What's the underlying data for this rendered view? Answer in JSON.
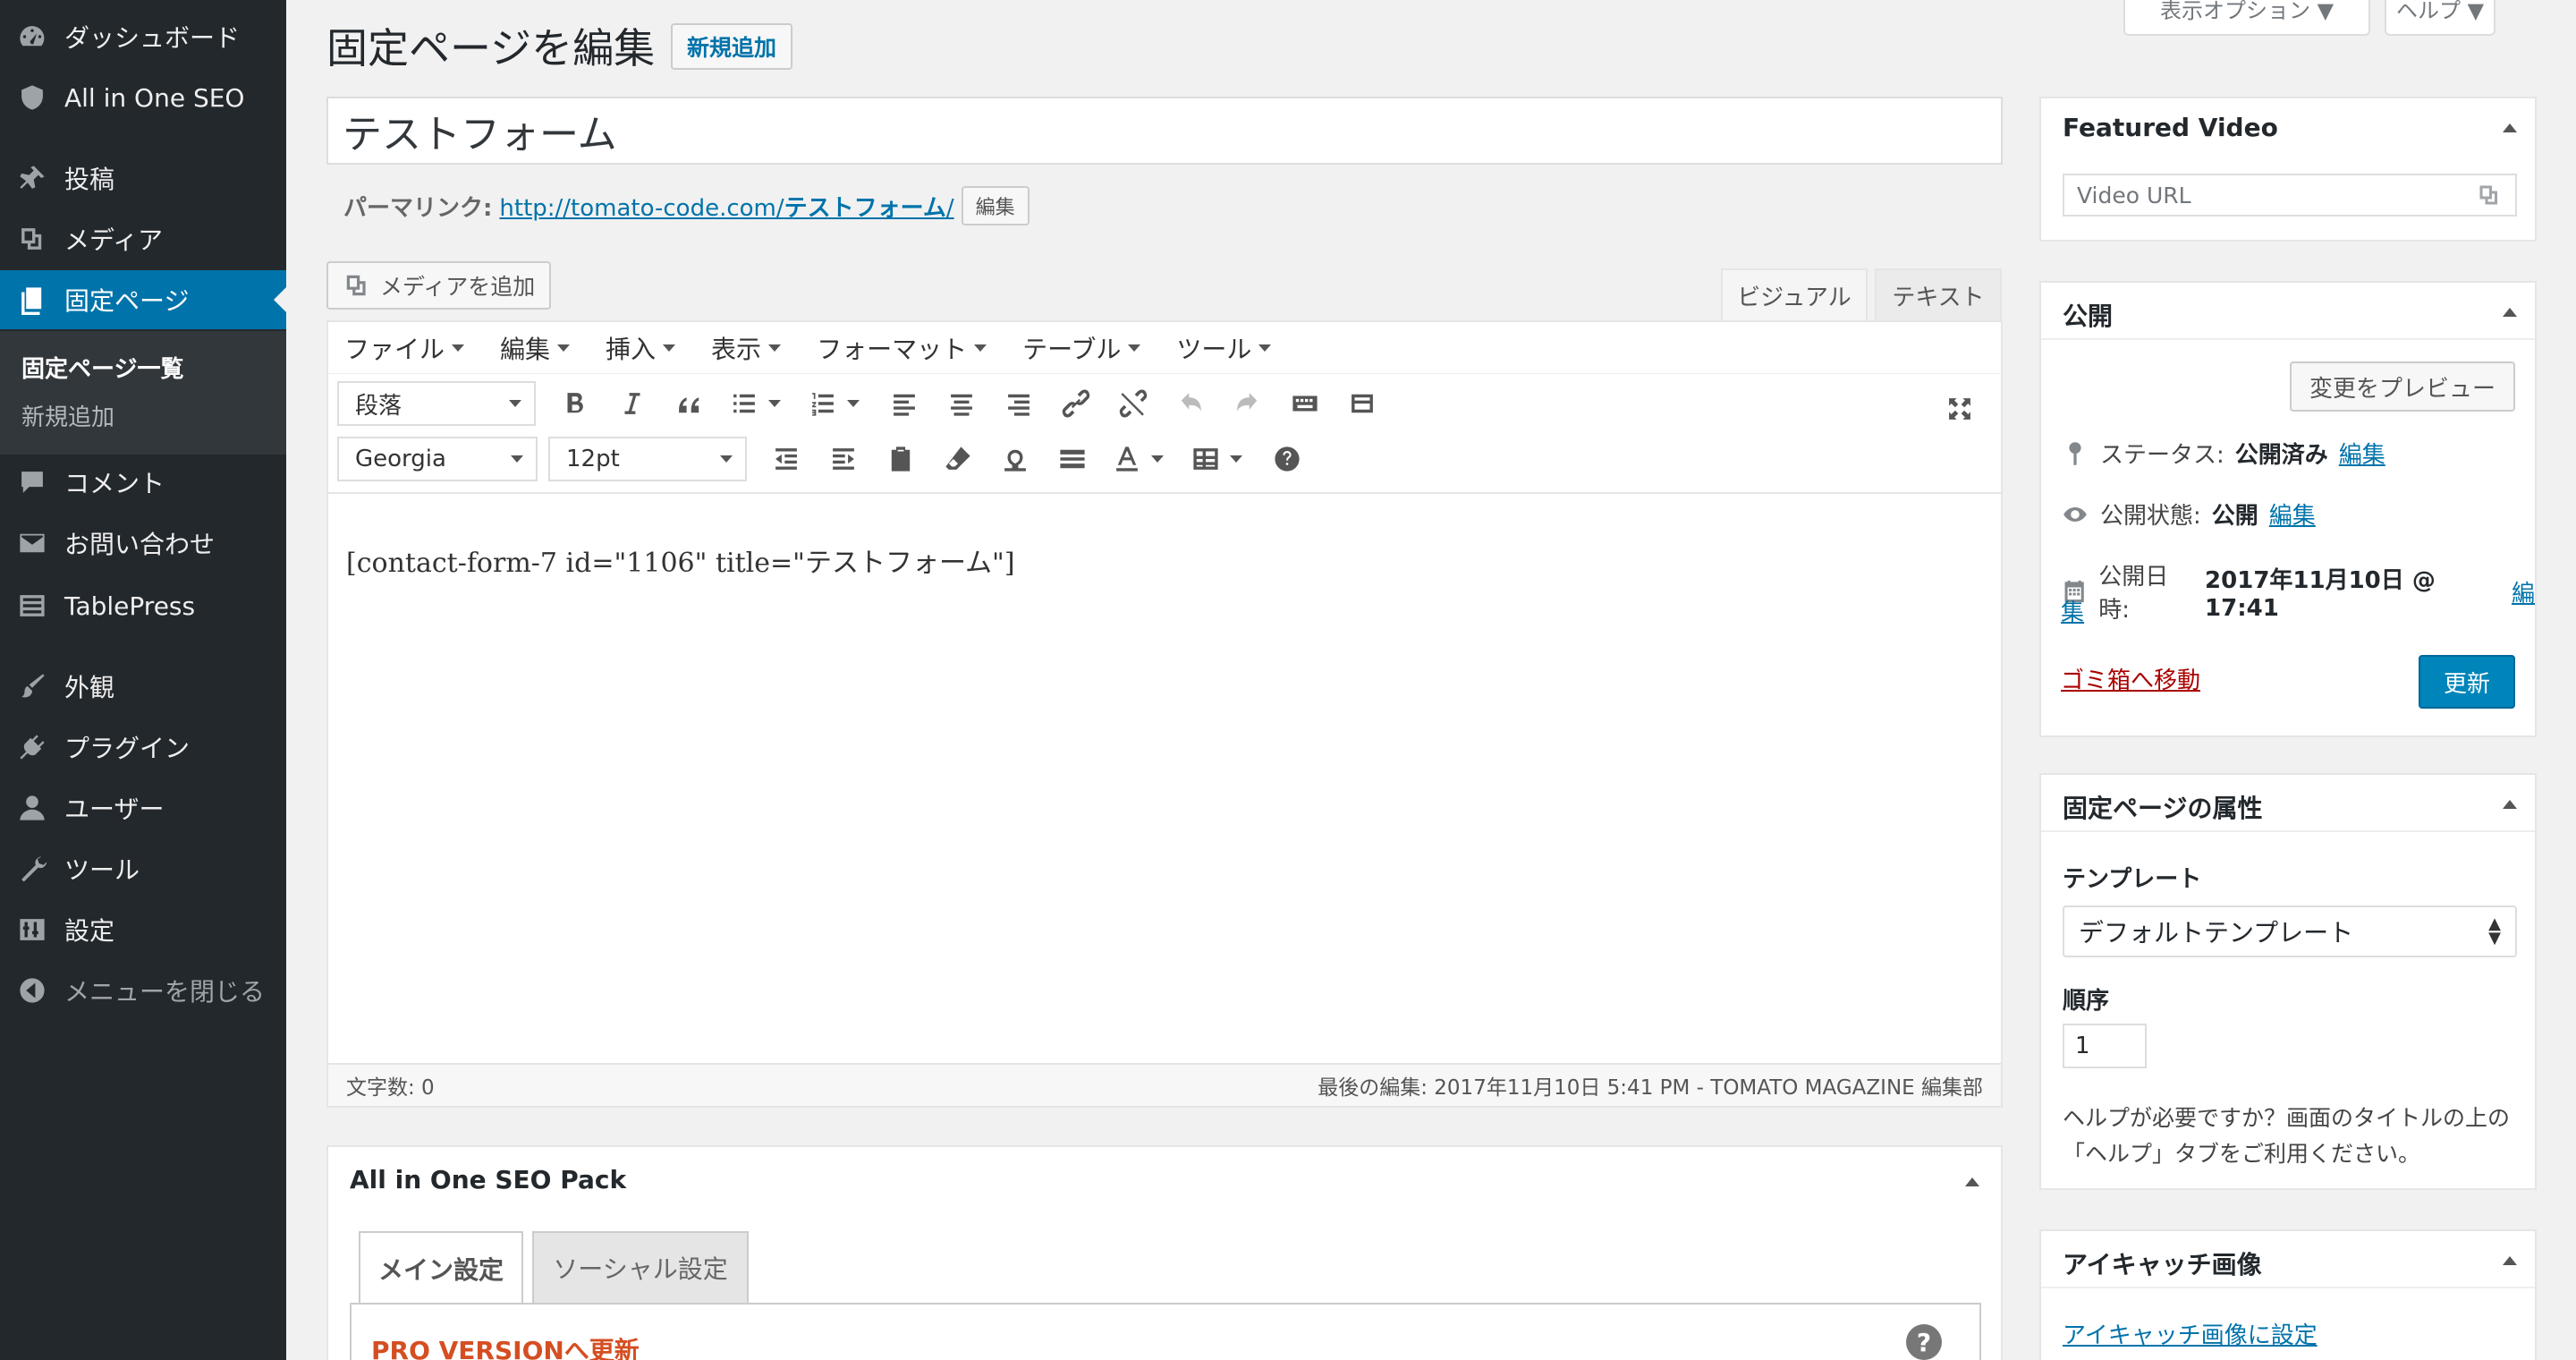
{
  "sidebar": {
    "items": [
      {
        "label": "ダッシュボード",
        "icon": "dashboard-icon"
      },
      {
        "label": "All in One SEO",
        "icon": "shield-icon"
      },
      {
        "label": "投稿",
        "icon": "pin-icon"
      },
      {
        "label": "メディア",
        "icon": "media-icon"
      },
      {
        "label": "固定ページ",
        "icon": "page-icon"
      },
      {
        "label": "コメント",
        "icon": "comment-icon"
      },
      {
        "label": "お問い合わせ",
        "icon": "mail-icon"
      },
      {
        "label": "TablePress",
        "icon": "table-icon"
      },
      {
        "label": "外観",
        "icon": "paintbrush-icon"
      },
      {
        "label": "プラグイン",
        "icon": "plugin-icon"
      },
      {
        "label": "ユーザー",
        "icon": "user-icon"
      },
      {
        "label": "ツール",
        "icon": "wrench-icon"
      },
      {
        "label": "設定",
        "icon": "settings-icon"
      },
      {
        "label": "メニューを閉じる",
        "icon": "collapse-icon"
      }
    ],
    "submenu": [
      "固定ページ一覧",
      "新規追加"
    ]
  },
  "screen_meta": {
    "options": "表示オプション ▼",
    "help": "ヘルプ ▼"
  },
  "header": {
    "title": "固定ページを編集",
    "add_new": "新規追加"
  },
  "title_input": "テストフォーム",
  "permalink": {
    "label": "パーマリンク:",
    "base": "http://tomato-code.com/",
    "slug": "テストフォーム",
    "trail": "/",
    "edit": "編集"
  },
  "editor": {
    "add_media": "メディアを追加",
    "tab_visual": "ビジュアル",
    "tab_text": "テキスト",
    "menubar": [
      "ファイル",
      "編集",
      "挿入",
      "表示",
      "フォーマット",
      "テーブル",
      "ツール"
    ],
    "block_format": "段落",
    "font_family": "Georgia",
    "font_size": "12pt",
    "content": "[contact-form-7 id=\"1106\" title=\"テストフォーム\"]",
    "word_count": "文字数: 0",
    "last_edit": "最後の編集: 2017年11月10日 5:41 PM - TOMATO MAGAZINE 編集部"
  },
  "seo_box": {
    "title": "All in One SEO Pack",
    "tab_main": "メイン設定",
    "tab_social": "ソーシャル設定",
    "pro": "PRO VERSIONへ更新",
    "help": "?"
  },
  "featured_video": {
    "title": "Featured Video",
    "placeholder": "Video URL"
  },
  "publish": {
    "title": "公開",
    "preview": "変更をプレビュー",
    "status_label": "ステータス:",
    "status_value": "公開済み",
    "visibility_label": "公開状態:",
    "visibility_value": "公開",
    "date_label": "公開日時:",
    "date_value": "2017年11月10日 @ 17:41",
    "edit_a": "編",
    "edit_b": "集",
    "edit": "編集",
    "trash": "ゴミ箱へ移動",
    "update": "更新"
  },
  "page_attributes": {
    "title": "固定ページの属性",
    "template_label": "テンプレート",
    "template_value": "デフォルトテンプレート",
    "order_label": "順序",
    "order_value": "1",
    "help_text": "ヘルプが必要ですか？画面のタイトルの上の「ヘルプ」タブをご利用ください。"
  },
  "featured_image": {
    "title": "アイキャッチ画像",
    "link": "アイキャッチ画像に設定"
  },
  "colors": {
    "sidebar": "#23282d",
    "accent": "#0073aa",
    "update_button": "#0085ba",
    "trash": "#a00",
    "pro": "#d54e21"
  }
}
